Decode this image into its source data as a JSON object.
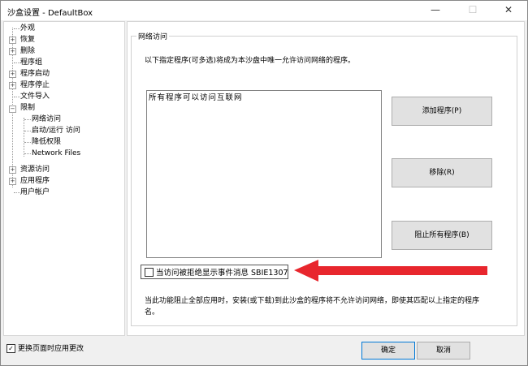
{
  "window": {
    "title": "沙盒设置 - DefaultBox",
    "minimize": "—",
    "maximize": "☐",
    "close": "✕"
  },
  "tree": {
    "items": [
      {
        "label": "外观",
        "level": 0,
        "expander": "none"
      },
      {
        "label": "恢复",
        "level": 0,
        "expander": "plus"
      },
      {
        "label": "删除",
        "level": 0,
        "expander": "plus"
      },
      {
        "label": "程序组",
        "level": 0,
        "expander": "none"
      },
      {
        "label": "程序启动",
        "level": 0,
        "expander": "plus"
      },
      {
        "label": "程序停止",
        "level": 0,
        "expander": "plus"
      },
      {
        "label": "文件导入",
        "level": 0,
        "expander": "none"
      },
      {
        "label": "限制",
        "level": 0,
        "expander": "minus"
      },
      {
        "label": "网络访问",
        "level": 1,
        "expander": "none"
      },
      {
        "label": "启动/运行 访问",
        "level": 1,
        "expander": "none"
      },
      {
        "label": "降低权限",
        "level": 1,
        "expander": "none"
      },
      {
        "label": "Network Files",
        "level": 1,
        "expander": "none"
      },
      {
        "label": "资源访问",
        "level": 0,
        "expander": "plus"
      },
      {
        "label": "应用程序",
        "level": 0,
        "expander": "plus"
      },
      {
        "label": "用户帐户",
        "level": 0,
        "expander": "none"
      }
    ]
  },
  "network_access": {
    "group_title": "网络访问",
    "description": "以下指定程序(可多选)将成为本沙盘中唯一允许访问网络的程序。",
    "list_items": [
      "所有程序可以访问互联网"
    ],
    "add_button": "添加程序(P)",
    "remove_button": "移除(R)",
    "block_all_button": "阻止所有程序(B)",
    "notify_checkbox_label": "当访问被拒绝显示事件消息 SBIE1307",
    "notify_checked": false,
    "note": "当此功能阻止全部应用时，安装(或下载)到此沙盒的程序将不允许访问网络，即使其匹配以上指定的程序名。"
  },
  "footer": {
    "apply_on_page_change_label": "更换页面时应用更改",
    "apply_on_page_change_checked": true,
    "ok_button": "确定",
    "cancel_button": "取消"
  },
  "annotation": {
    "arrow_color": "#e8262d"
  }
}
